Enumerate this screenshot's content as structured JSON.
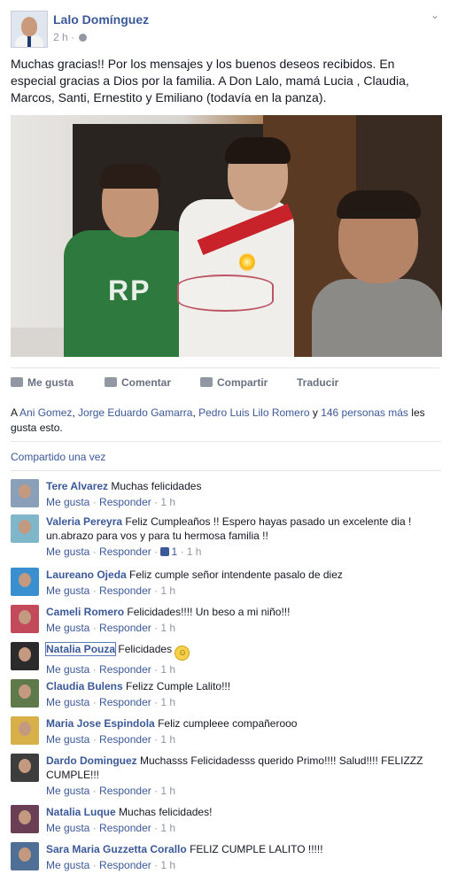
{
  "post": {
    "author": "Lalo Domínguez",
    "time": "2 h ·",
    "text": "Muchas gracias!! Por los mensajes y los buenos deseos recibidos. En especial gracias a Dios por la familia. A Don Lalo, mamá Lucia , Claudia, Marcos, Santi, Ernestito y Emiliano (todavía en la panza).",
    "photo_text": "RP"
  },
  "actions": {
    "like": "Me gusta",
    "comment": "Comentar",
    "share": "Compartir",
    "translate": "Traducir"
  },
  "likes": {
    "prefix": "A ",
    "names": [
      "Ani Gomez",
      "Jorge Eduardo Gamarra",
      "Pedro Luis Lilo Romero"
    ],
    "sep1": ", ",
    "sep2": ", ",
    "and": " y ",
    "more": "146 personas más",
    "suffix": " les gusta esto."
  },
  "shared": "Compartido una vez",
  "comment_meta": {
    "like": "Me gusta",
    "reply": "Responder",
    "dot": " · "
  },
  "comments": [
    {
      "name": "Tere Alvarez",
      "text": "Muchas felicidades",
      "time": "1 h",
      "avatar": "#8aa0b8"
    },
    {
      "name": "Valeria Pereyra",
      "text": "Feliz Cumpleaños !! Espero hayas pasado un excelente dia ! un.abrazo para vos y para tu hermosa familia !!",
      "time": "1 h",
      "likes": "1",
      "avatar": "#7fb6c9"
    },
    {
      "name": "Laureano Ojeda",
      "text": "Feliz cumple señor intendente pasalo de diez",
      "time": "1 h",
      "avatar": "#3a8fd0"
    },
    {
      "name": "Cameli Romero",
      "text": "Felicidades!!!! Un beso a mi niño!!!",
      "time": "1 h",
      "avatar": "#c24a5a"
    },
    {
      "name": "Natalia Pouza",
      "text": "Felicidades",
      "time": "1 h",
      "avatar": "#2b2b2b",
      "emoji": "smile-emoji"
    },
    {
      "name": "Claudia Bulens",
      "text": "Felizz Cumple Lalito!!!",
      "time": "1 h",
      "avatar": "#5f7a4a"
    },
    {
      "name": "Maria Jose Espindola",
      "text": "Feliz cumpleee compañerooo",
      "time": "1 h",
      "avatar": "#d8b04a"
    },
    {
      "name": "Dardo Dominguez",
      "text": "Muchasss Felicidadesss querido Primo!!!! Salud!!!! FELIZZZ CUMPLE!!!",
      "time": "1 h",
      "avatar": "#3d3d3d"
    },
    {
      "name": "Natalia Luque",
      "text": "Muchas felicidades!",
      "time": "1 h",
      "avatar": "#6a3f55"
    },
    {
      "name": "Sara Maria Guzzetta Corallo",
      "text": "FELIZ CUMPLE LALITO !!!!!",
      "time": "1 h",
      "avatar": "#4f6f95"
    }
  ]
}
